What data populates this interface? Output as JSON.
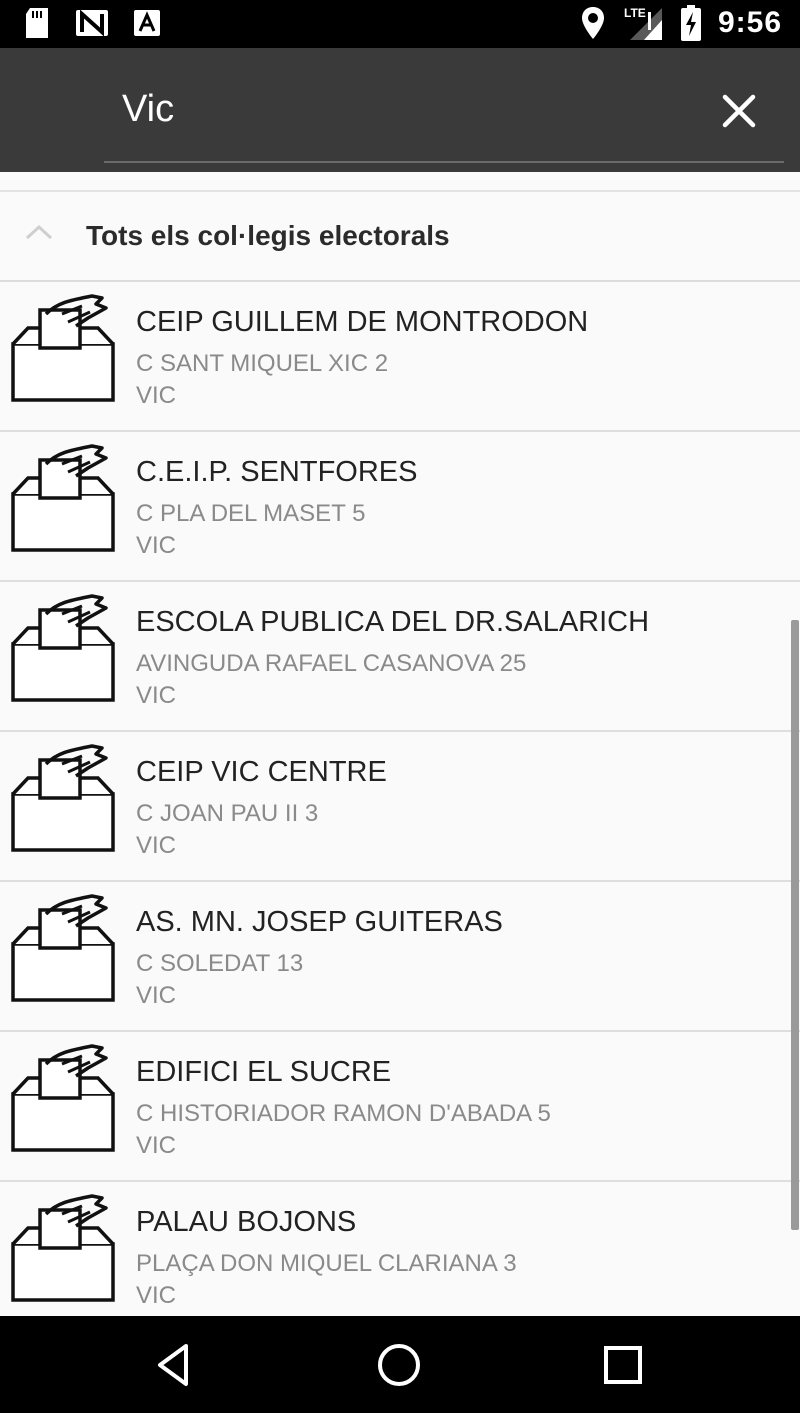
{
  "status_bar": {
    "time": "9:56",
    "left_icons": [
      "sd-card-icon",
      "nfc-icon",
      "a-icon"
    ],
    "right_icons": [
      "location-icon",
      "lte-signal-icon",
      "battery-charging-icon"
    ]
  },
  "search": {
    "value": "Vic",
    "clear_icon": "close-icon"
  },
  "section": {
    "title": "Tots els col·legis electorals",
    "expanded": true
  },
  "polling_stations": [
    {
      "name": "CEIP GUILLEM DE MONTRODON",
      "address": "C SANT MIQUEL XIC 2",
      "city": "VIC"
    },
    {
      "name": "C.E.I.P. SENTFORES",
      "address": "C PLA DEL MASET 5",
      "city": "VIC"
    },
    {
      "name": "ESCOLA PUBLICA DEL DR.SALARICH",
      "address": "AVINGUDA RAFAEL CASANOVA 25",
      "city": "VIC"
    },
    {
      "name": "CEIP VIC CENTRE",
      "address": "C JOAN PAU II 3",
      "city": "VIC"
    },
    {
      "name": "AS. MN. JOSEP GUITERAS",
      "address": "C SOLEDAT 13",
      "city": "VIC"
    },
    {
      "name": "EDIFICI EL SUCRE",
      "address": "C HISTORIADOR RAMON D'ABADA 5",
      "city": "VIC"
    },
    {
      "name": "PALAU BOJONS",
      "address": "PLAÇA  DON MIQUEL CLARIANA 3",
      "city": "VIC"
    }
  ],
  "item_icon": "ballot-box-icon",
  "nav": [
    "back-icon",
    "home-icon",
    "recents-icon"
  ],
  "colors": {
    "app_bar": "#3a3a3a",
    "status_bar": "#000000",
    "background": "#fafafa",
    "title_text": "#222222",
    "secondary_text": "#8a8a8a"
  }
}
